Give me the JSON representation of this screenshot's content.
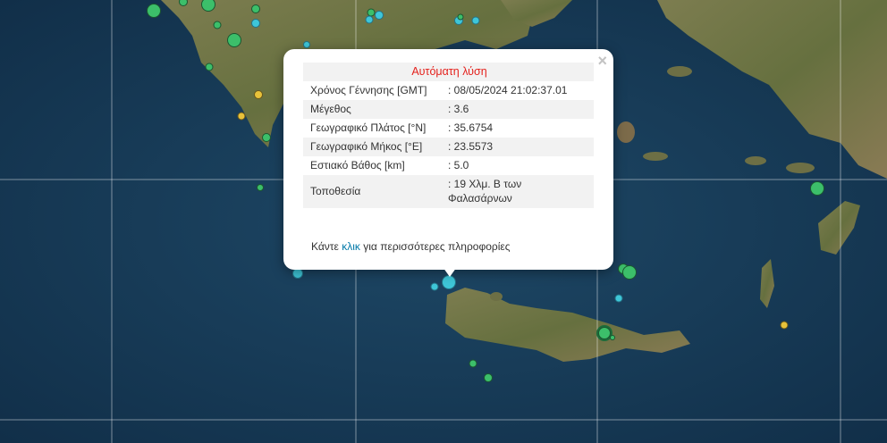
{
  "popup": {
    "title": "Αυτόματη λύση",
    "close": "×",
    "rows": [
      {
        "label": "Χρόνος Γέννησης [GMT]",
        "value": ": 08/05/2024 21:02:37.01"
      },
      {
        "label": "Μέγεθος",
        "value": ": 3.6"
      },
      {
        "label": "Γεωγραφικό Πλάτος [°N]",
        "value": ": 35.6754"
      },
      {
        "label": "Γεωγραφικό Μήκος [°E]",
        "value": ": 23.5573"
      },
      {
        "label": "Εστιακό Βάθος [km]",
        "value": ": 5.0"
      },
      {
        "label": "Τοποθεσία",
        "value": ": 19 Χλμ. Β των Φαλασάρνων"
      }
    ],
    "more_prefix": "Κάντε",
    "more_link": "κλικ",
    "more_suffix": "για περισσότερες πληροφορίες"
  },
  "map": {
    "colors": {
      "sea": "#173c5a",
      "land": "#6f7446",
      "popup_title": "#e4211c",
      "link": "#0078a8"
    }
  }
}
